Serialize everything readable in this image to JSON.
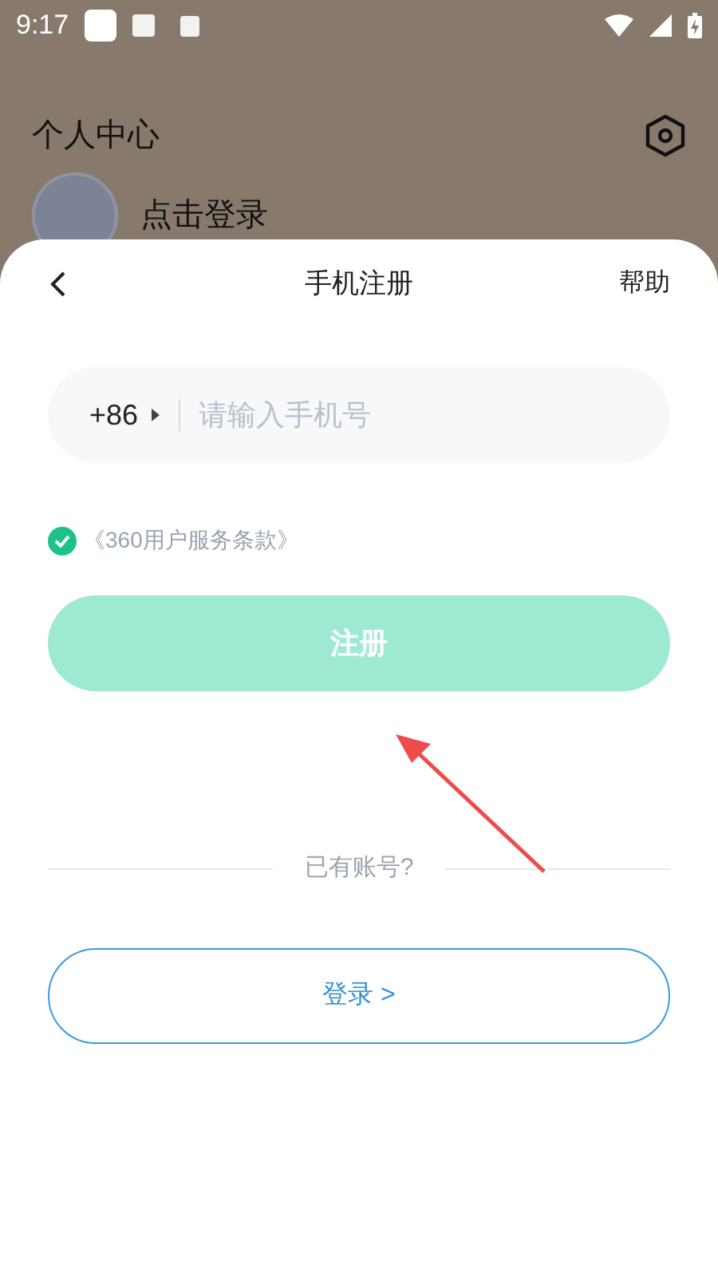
{
  "status_bar": {
    "time": "9:17"
  },
  "background": {
    "title": "个人中心",
    "user_label": "点击登录"
  },
  "sheet": {
    "title": "手机注册",
    "help": "帮助",
    "phone": {
      "country_code": "+86",
      "placeholder": "请输入手机号"
    },
    "agreement": {
      "checked": true,
      "text": "《360用户服务条款》"
    },
    "register_button": {
      "label": "注册",
      "disabled": true
    },
    "divider_text": "已有账号?",
    "login_button": {
      "label": "登录 >"
    }
  }
}
